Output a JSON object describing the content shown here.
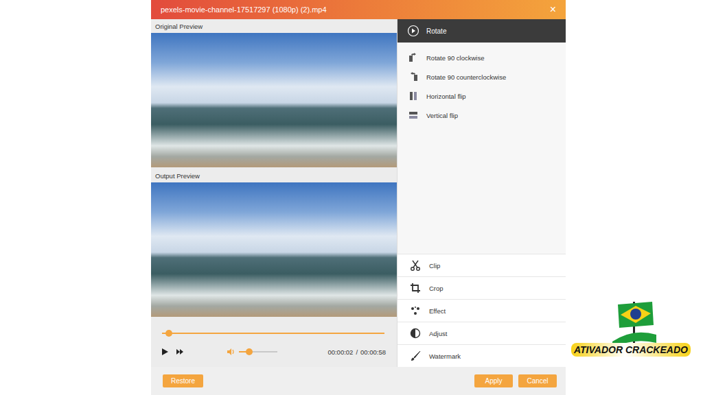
{
  "window": {
    "title": "pexels-movie-channel-17517297 (1080p) (2).mp4",
    "close": "×"
  },
  "previews": [
    {
      "label": "Original Preview"
    },
    {
      "label": "Output Preview"
    }
  ],
  "player": {
    "progress": {
      "level": 0.03
    },
    "volume": {
      "level": 0.27
    },
    "time": {
      "current": "00:00:02",
      "separator": "/",
      "total": "00:00:58"
    }
  },
  "active_tool": {
    "label": "Rotate",
    "selected": true
  },
  "rotate_options": [
    {
      "label": "Rotate 90 clockwise"
    },
    {
      "label": "Rotate 90 counterclockwise"
    },
    {
      "label": "Horizontal flip"
    },
    {
      "label": "Vertical flip"
    }
  ],
  "tools": [
    {
      "label": "Clip",
      "selected": false
    },
    {
      "label": "Crop",
      "selected": false
    },
    {
      "label": "Effect",
      "selected": false
    },
    {
      "label": "Adjust",
      "selected": false
    },
    {
      "label": "Watermark",
      "selected": false
    }
  ],
  "buttons": {
    "restore": "Restore",
    "apply": "Apply",
    "cancel": "Cancel"
  },
  "watermark_logo": {
    "text": "ATIVADOR CRACKEADO"
  }
}
